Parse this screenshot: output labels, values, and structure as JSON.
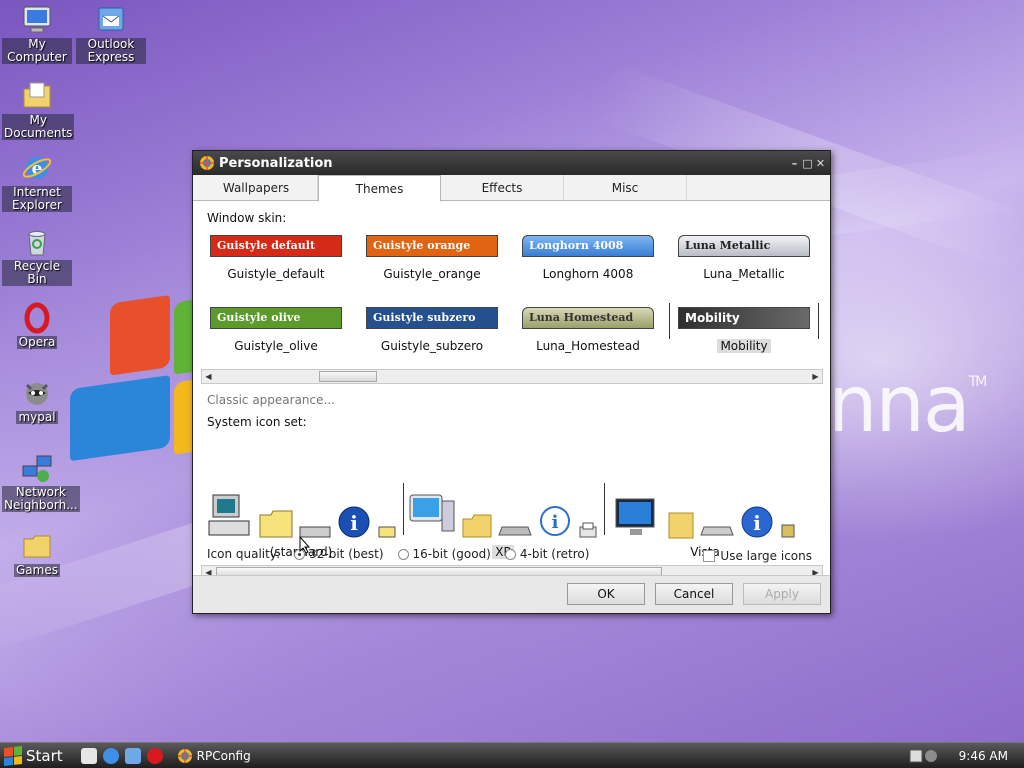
{
  "desktop": {
    "icons": [
      {
        "label": "My Computer",
        "icon": "computer-icon"
      },
      {
        "label": "Outlook Express",
        "icon": "mail-icon"
      },
      {
        "label": "My Documents",
        "icon": "folder-icon"
      },
      {
        "label": "Internet Explorer",
        "icon": "ie-icon"
      },
      {
        "label": "Recycle Bin",
        "icon": "recycle-bin-icon"
      },
      {
        "label": "Opera",
        "icon": "opera-icon"
      },
      {
        "label": "mypal",
        "icon": "raccoon-icon"
      },
      {
        "label": "Network Neighborh...",
        "icon": "network-icon"
      },
      {
        "label": "Games",
        "icon": "folder-icon"
      }
    ],
    "brand_text": "nna",
    "brand_mark": "TM"
  },
  "window": {
    "title": "Personalization",
    "tabs": [
      {
        "label": "Wallpapers",
        "active": false
      },
      {
        "label": "Themes",
        "active": true
      },
      {
        "label": "Effects",
        "active": false
      },
      {
        "label": "Misc",
        "active": false
      }
    ],
    "window_skin_label": "Window skin:",
    "skins": [
      {
        "bar_text": "Guistyle default",
        "name": "Guistyle_default",
        "color": "#d42a17"
      },
      {
        "bar_text": "Guistyle orange",
        "name": "Guistyle_orange",
        "color": "#e06412"
      },
      {
        "bar_text": "Longhorn 4008",
        "name": "Longhorn 4008",
        "color": "#4a8fd8"
      },
      {
        "bar_text": "Luna Metallic",
        "name": "Luna_Metallic",
        "color": "#c9ccd6"
      },
      {
        "bar_text": "Guistyle olive",
        "name": "Guistyle_olive",
        "color": "#5c9a2c"
      },
      {
        "bar_text": "Guistyle subzero",
        "name": "Guistyle_subzero",
        "color": "#24508e"
      },
      {
        "bar_text": "Luna Homestead",
        "name": "Luna_Homestead",
        "color": "#a7ad7c"
      },
      {
        "bar_text": "Mobility",
        "name": "Mobility",
        "color": "#3a3a3a"
      }
    ],
    "selected_skin": "Mobility",
    "classic_label": "Classic appearance...",
    "icon_set_label": "System icon set:",
    "icon_sets": [
      {
        "name": "(standard)"
      },
      {
        "name": "XP"
      },
      {
        "name": "Vista"
      }
    ],
    "selected_icon_set": "XP",
    "icon_quality_label": "Icon quality:",
    "quality_options": [
      {
        "label": "32-bit (best)",
        "selected": true
      },
      {
        "label": "16-bit (good)",
        "selected": false
      },
      {
        "label": "4-bit (retro)",
        "selected": false
      }
    ],
    "large_icons_label": "Use large icons",
    "large_icons_checked": false,
    "buttons": {
      "ok": "OK",
      "cancel": "Cancel",
      "apply": "Apply"
    }
  },
  "taskbar": {
    "start_label": "Start",
    "task_label": "RPConfig",
    "clock": "9:46 AM"
  }
}
